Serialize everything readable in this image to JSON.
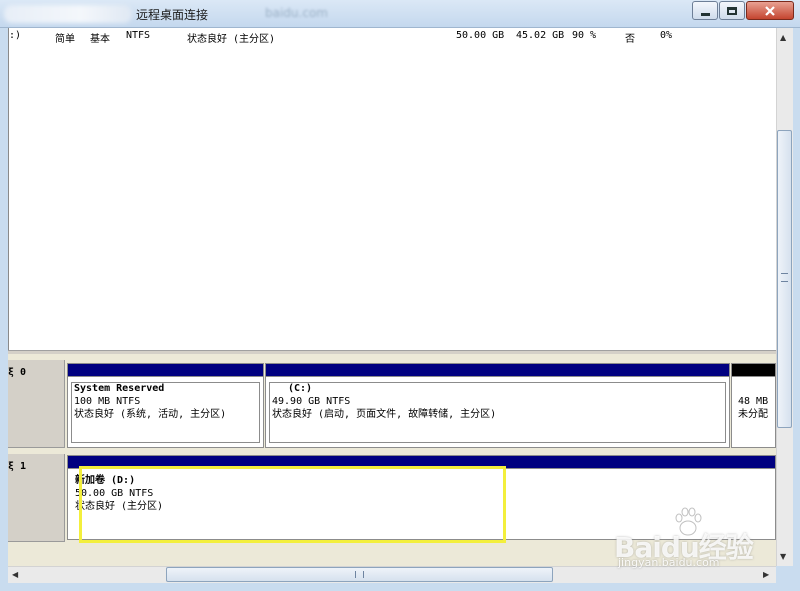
{
  "window": {
    "title": "远程桌面连接",
    "blurred_url": "baidu.com"
  },
  "volume_table": {
    "rows": [
      {
        "volume": ":)",
        "layout": "简单",
        "type": "基本",
        "filesystem": "NTFS",
        "status": "状态良好 (主分区)",
        "capacity": "50.00 GB",
        "free_space": "45.02 GB",
        "percent_free": "90 %",
        "fault_tolerance": "否",
        "overhead": "0%"
      }
    ]
  },
  "disks": [
    {
      "label": "ξ 0",
      "partitions": [
        {
          "name": "System Reserved",
          "size": "100 MB NTFS",
          "status": "状态良好 (系统, 活动, 主分区)"
        },
        {
          "name": "(C:)",
          "size": "49.90 GB NTFS",
          "status": "状态良好 (启动, 页面文件, 故障转储, 主分区)"
        },
        {
          "name": "",
          "size": "48 MB",
          "status": "未分配"
        }
      ]
    },
    {
      "label": "ξ 1",
      "partitions": [
        {
          "name": "新加卷  (D:)",
          "size": "50.00 GB NTFS",
          "status": "状态良好 (主分区)"
        }
      ]
    }
  ],
  "scrollbar": {
    "h_grip": "|||",
    "v_grip": "≡"
  },
  "watermark": {
    "logo": "Baidu经验",
    "url": "jingyan.baidu.com"
  },
  "colors": {
    "partition_bar_primary": "#000080",
    "partition_bar_unallocated": "#000000",
    "highlight_box": "#f3ef3c",
    "window_title_bg": "#c4d8ee"
  }
}
